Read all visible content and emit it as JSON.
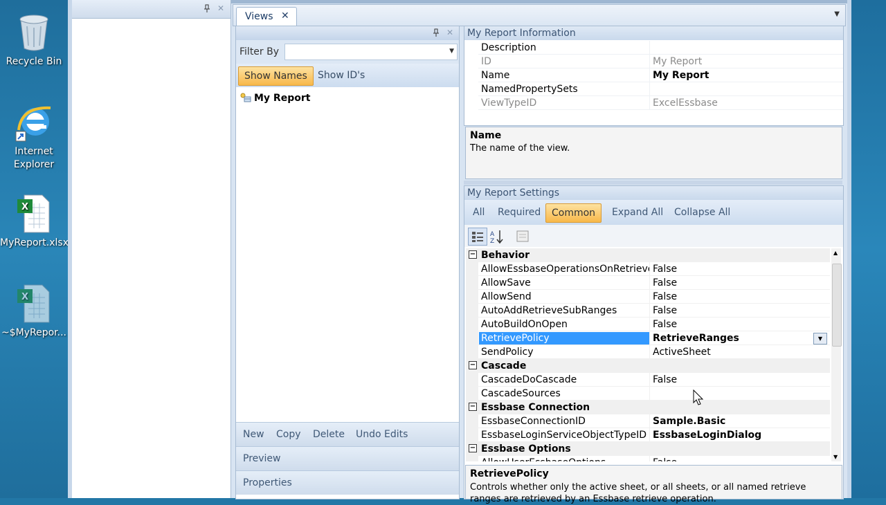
{
  "desktop": {
    "icons": [
      {
        "label": "Recycle Bin",
        "icon": "recycle-bin-icon"
      },
      {
        "label": "Internet Explorer",
        "label_lines": [
          "Internet",
          "Explorer"
        ],
        "icon": "internet-explorer-icon"
      },
      {
        "label": "MyReport.xlsx",
        "icon": "excel-file-icon"
      },
      {
        "label": "~$MyRepor...",
        "icon": "excel-file-icon"
      }
    ]
  },
  "tabs": [
    {
      "label": "Views",
      "close": "✕"
    }
  ],
  "views_panel": {
    "filter_label": "Filter By",
    "filter_value": "",
    "toggle_show_names": "Show Names",
    "toggle_show_ids": "Show ID's",
    "items": [
      {
        "label": "My Report"
      }
    ],
    "actions": {
      "new": "New",
      "copy": "Copy",
      "delete": "Delete",
      "undo": "Undo Edits"
    },
    "sections": {
      "preview": "Preview",
      "properties": "Properties"
    }
  },
  "report_info": {
    "title": "My Report Information",
    "rows": [
      {
        "key": "Description",
        "value": "",
        "key_dim": false,
        "value_bold": false
      },
      {
        "key": "ID",
        "value": "My Report",
        "key_dim": true,
        "value_bold": false
      },
      {
        "key": "Name",
        "value": "My Report",
        "key_dim": false,
        "value_bold": true
      },
      {
        "key": "NamedPropertySets",
        "value": "",
        "key_dim": false,
        "value_bold": false
      },
      {
        "key": "ViewTypeID",
        "value": "ExcelEssbase",
        "key_dim": true,
        "value_bold": false
      }
    ],
    "description_title": "Name",
    "description_text": "The name of the view."
  },
  "report_settings": {
    "title": "My Report Settings",
    "filter_tabs": [
      "All",
      "Required",
      "Common",
      "Expand All",
      "Collapse All"
    ],
    "active_filter": "Common",
    "categories": [
      {
        "name": "Behavior",
        "props": [
          {
            "key": "AllowEssbaseOperationsOnRetrieveRanges",
            "value": "False",
            "bold": false
          },
          {
            "key": "AllowSave",
            "value": "False",
            "bold": false
          },
          {
            "key": "AllowSend",
            "value": "False",
            "bold": false
          },
          {
            "key": "AutoAddRetrieveSubRanges",
            "value": "False",
            "bold": false
          },
          {
            "key": "AutoBuildOnOpen",
            "value": "False",
            "bold": false
          },
          {
            "key": "RetrievePolicy",
            "value": "RetrieveRanges",
            "bold": true,
            "selected": true
          },
          {
            "key": "SendPolicy",
            "value": "ActiveSheet",
            "bold": false
          }
        ]
      },
      {
        "name": "Cascade",
        "props": [
          {
            "key": "CascadeDoCascade",
            "value": "False",
            "bold": false
          },
          {
            "key": "CascadeSources",
            "value": "",
            "bold": false
          }
        ]
      },
      {
        "name": "Essbase Connection",
        "props": [
          {
            "key": "EssbaseConnectionID",
            "value": "Sample.Basic",
            "bold": true
          },
          {
            "key": "EssbaseLoginServiceObjectTypeID",
            "value": "EssbaseLoginDialog",
            "bold": true
          }
        ]
      },
      {
        "name": "Essbase Options",
        "props": [
          {
            "key": "AllowUserEssbaseOptions",
            "value": "False",
            "bold": false
          }
        ]
      }
    ],
    "description_title": "RetrievePolicy",
    "description_text": "Controls whether only the active sheet, or all sheets, or all named retrieve ranges are retrieved by an Essbase retrieve operation."
  },
  "glyphs": {
    "pin": "📌",
    "close": "✕",
    "collapse": "−",
    "dropdown": "▼"
  }
}
